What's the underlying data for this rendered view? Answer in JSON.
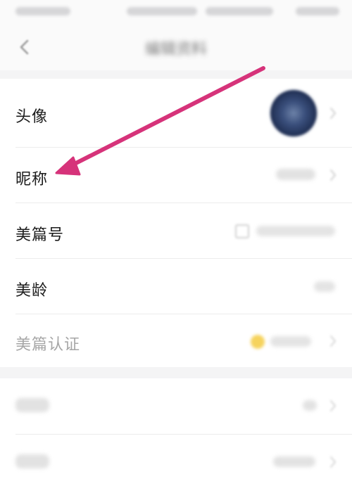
{
  "header": {
    "title": "编辑资料",
    "back_icon": "back-arrow-icon"
  },
  "profile": {
    "avatar": {
      "label": "头像",
      "avatar_icon": "avatar-image"
    },
    "nickname": {
      "label": "昵称",
      "value": ""
    },
    "meipian_id": {
      "label": "美篇号",
      "value": ""
    },
    "meipian_age": {
      "label": "美龄",
      "value": ""
    },
    "verification": {
      "label": "美篇认证",
      "value": ""
    }
  },
  "details": {
    "gender": {
      "label": "",
      "value": ""
    },
    "birthday": {
      "label": "",
      "value": ""
    }
  },
  "annotation": {
    "color": "#d6337a",
    "icon": "pointer-arrow"
  },
  "colors": {
    "background": "#f4f4f5",
    "row_background": "#ffffff",
    "divider": "#ececec"
  }
}
